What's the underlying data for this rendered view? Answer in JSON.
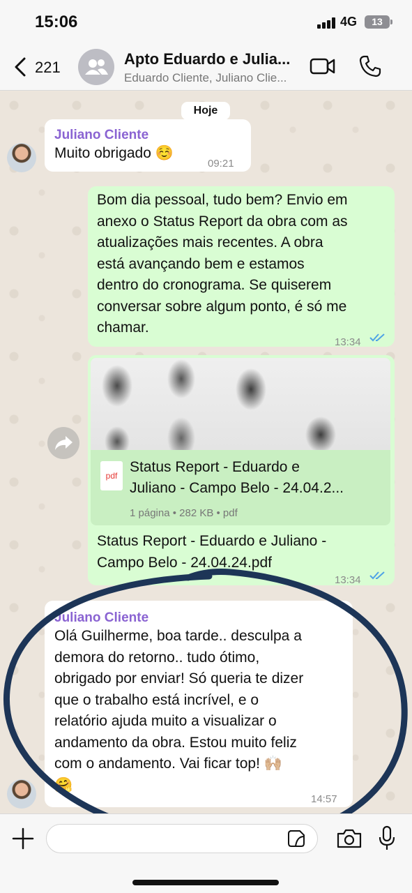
{
  "status_bar": {
    "time": "15:06",
    "network": "4G",
    "battery": "13"
  },
  "header": {
    "back_count": "221",
    "title": "Apto Eduardo e Julia...",
    "subtitle": "Eduardo Cliente, Juliano Clie..."
  },
  "chat": {
    "date_pill": "Hoje",
    "messages": [
      {
        "sender": "Juliano Cliente",
        "text": "Muito obrigado ☺️",
        "time": "09:21"
      },
      {
        "lines": [
          "Bom dia pessoal, tudo bem? Envio em",
          "anexo o Status Report da obra com as",
          "atualizações mais recentes. A obra",
          "está avançando bem e estamos",
          "dentro do cronograma. Se quiserem",
          "conversar sobre algum ponto, é só me",
          "chamar."
        ],
        "time": "13:34"
      },
      {
        "doc_name_line1": "Status Report - Eduardo e",
        "doc_name_line2": "Juliano - Campo Belo - 24.04.2...",
        "doc_type_icon": "pdf",
        "doc_meta": "1 página • 282 KB • pdf",
        "caption_line1": "Status Report - Eduardo e Juliano -",
        "caption_line2": "Campo Belo - 24.04.24.pdf",
        "time": "13:34"
      },
      {
        "sender": "Juliano Cliente",
        "lines": [
          "Olá Guilherme, boa tarde.. desculpa a",
          "demora do retorno.. tudo ótimo,",
          "obrigado por enviar! Só queria te dizer",
          "que o trabalho está incrível, e o",
          "relatório ajuda muito a visualizar o",
          "andamento da obra. Estou muito feliz",
          "com o andamento. Vai ficar top! 🙌🏼",
          "🤗"
        ],
        "time": "14:57"
      }
    ]
  },
  "input": {
    "placeholder": ""
  },
  "colors": {
    "outgoing_bubble": "#d9fdd3",
    "sender_name": "#8a63d2",
    "read_ticks": "#4fa3e6",
    "ink": "#1d3557"
  }
}
